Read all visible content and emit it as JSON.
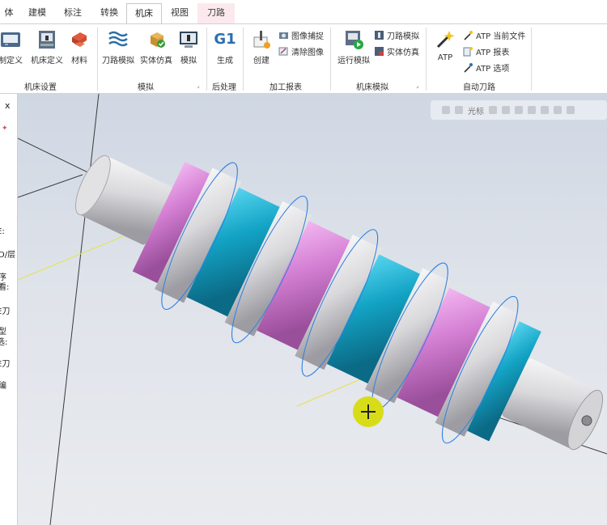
{
  "tabs": [
    {
      "label": "体",
      "active": false
    },
    {
      "label": "建模",
      "active": false
    },
    {
      "label": "标注",
      "active": false
    },
    {
      "label": "转换",
      "active": false
    },
    {
      "label": "机床",
      "active": true
    },
    {
      "label": "视图",
      "active": false
    },
    {
      "label": "刀路",
      "active": false
    }
  ],
  "ribbon": {
    "groups": [
      {
        "label": "机床设置"
      },
      {
        "label": "模拟"
      },
      {
        "label": "后处理"
      },
      {
        "label": "加工报表"
      },
      {
        "label": "机床模拟"
      },
      {
        "label": "自动刀路"
      }
    ],
    "tools": {
      "control_def": "制定义",
      "machine_def": "机床定义",
      "material": "材料",
      "toolpath_sim": "刀路模拟",
      "solid_sim": "实体仿真",
      "simulate": "模拟",
      "g1_icon": "G1",
      "generate": "生成",
      "create": "创建",
      "image_capture": "图像捕捉",
      "clear_image": "清除图像",
      "run_sim": "运行模拟",
      "toolpath_sim2": "刀路模拟",
      "solid_sim2": "实体仿真",
      "atp": "ATP",
      "atp_current": "ATP 当前文件",
      "atp_report": "ATP 报表",
      "atp_options": "ATP 选项"
    }
  },
  "left_panel": {
    "close": "x",
    "fragments": [
      "E:",
      "D/层",
      "序",
      "看:",
      "E刀",
      "型",
      "选:",
      "E刀",
      "编"
    ]
  },
  "viewport": {
    "toolbar_label": "光标",
    "colors": {
      "cyan": "#13a3c4",
      "pink": "#d47fd3",
      "white": "#e6e6e8",
      "background_top": "#cfd7e3",
      "cursor": "#d8dc18"
    }
  }
}
